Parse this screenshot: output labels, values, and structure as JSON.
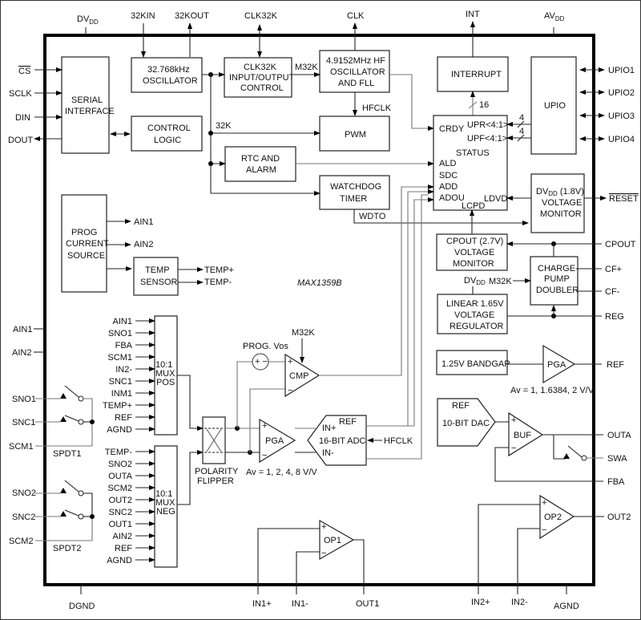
{
  "title": "MAX1359B",
  "power_pins": {
    "dvdd": "DV",
    "dvdd_sub": "DD",
    "avdd": "AV",
    "avdd_sub": "DD",
    "dgnd": "DGND",
    "agnd": "AGND"
  },
  "top_pins": [
    "32KIN",
    "32KOUT",
    "CLK32K",
    "CLK",
    "INT"
  ],
  "left_pins": {
    "serial": [
      "CS",
      "SCLK",
      "DIN",
      "DOUT"
    ],
    "analog": [
      "AIN1",
      "AIN2"
    ],
    "spdt1": [
      "SNO1",
      "SNC1",
      "SCM1"
    ],
    "spdt2": [
      "SNO2",
      "SNC2",
      "SCM2"
    ]
  },
  "right_pins": [
    "UPIO1",
    "UPIO2",
    "UPIO3",
    "UPIO4",
    "RESET",
    "CPOUT",
    "CF+",
    "CF-",
    "REG",
    "REF",
    "OUTA",
    "SWA",
    "FBA",
    "OUT2"
  ],
  "bottom_pins": [
    "IN1+",
    "IN1-",
    "OUT1",
    "IN2+",
    "IN2-"
  ],
  "blocks": {
    "serial_interface": [
      "SERIAL",
      "INTERFACE"
    ],
    "osc32k": [
      "32.768kHz",
      "OSCILLATOR"
    ],
    "clk32k_ctrl": [
      "CLK32K",
      "INPUT/OUTPUT",
      "CONTROL"
    ],
    "hf_osc": [
      "4.9152MHz HF",
      "OSCILLATOR",
      "AND FLL"
    ],
    "interrupt": [
      "INTERRUPT"
    ],
    "upio": [
      "UPIO"
    ],
    "control_logic": [
      "CONTROL",
      "LOGIC"
    ],
    "pwm": [
      "PWM"
    ],
    "rtc": [
      "RTC AND",
      "ALARM"
    ],
    "watchdog": [
      "WATCHDOG",
      "TIMER"
    ],
    "status": {
      "title": "STATUS",
      "inputs_left": [
        "CRDY",
        "ALD",
        "SDC",
        "ADD",
        "ADOU"
      ],
      "inputs_right": [
        "UPR<4:1>",
        "UPF<4:1>",
        "LDVD"
      ],
      "bottom": "LCPD"
    },
    "dvdd_monitor": [
      "DV",
      "DD",
      " (1.8V)",
      "VOLTAGE",
      "MONITOR"
    ],
    "prog_current": [
      "PROG",
      "CURRENT",
      "SOURCE"
    ],
    "temp_sensor": [
      "TEMP",
      "SENSOR"
    ],
    "cpout_monitor": [
      "CPOUT (2.7V)",
      "VOLTAGE",
      "MONITOR"
    ],
    "charge_pump": [
      "CHARGE-",
      "PUMP",
      "DOUBLER"
    ],
    "linear_reg": [
      "LINEAR 1.65V",
      "VOLTAGE",
      "REGULATOR"
    ],
    "bandgap": [
      "1.25V BANDGAP"
    ],
    "pga_ref": "PGA",
    "pga_ref_gain": "Av = 1, 1.6384, 2 V/V",
    "dac": [
      "REF",
      "10-BIT DAC"
    ],
    "buf": "BUF",
    "mux_pos": {
      "label": [
        "10:1",
        "MUX",
        "POS"
      ],
      "inputs": [
        "AIN1",
        "SNO1",
        "FBA",
        "SCM1",
        "IN2-",
        "SNC1",
        "INM1",
        "TEMP+",
        "REF",
        "AGND"
      ]
    },
    "mux_neg": {
      "label": [
        "10:1",
        "MUX",
        "NEG"
      ],
      "inputs": [
        "TEMP-",
        "SNO2",
        "OUTA",
        "SCM2",
        "OUT2",
        "SNC2",
        "OUT1",
        "AIN2",
        "REF",
        "AGND"
      ]
    },
    "polarity_flipper": [
      "POLARITY",
      "FLIPPER"
    ],
    "prog_vos": "PROG. Vos",
    "cmp": "CMP",
    "pga_main": "PGA",
    "pga_main_gain": "Av = 1, 2, 4, 8 V/V",
    "adc": [
      "IN+",
      "REF",
      "16-BIT ADC",
      "IN-"
    ],
    "op1": "OP1",
    "op2": "OP2",
    "spdt1_label": "SPDT1",
    "spdt2_label": "SPDT2"
  },
  "signals": {
    "m32k": "M32K",
    "hfclk": "HFCLK",
    "k32": "32K",
    "wdto": "WDTO",
    "bus16": "16",
    "bus4a": "4",
    "bus4b": "4",
    "prog_ain1": "AIN1",
    "prog_ain2": "AIN2",
    "temp_p": "TEMP+",
    "temp_n": "TEMP-",
    "dvdd_reg": "DV",
    "dvdd_reg_sub": "DD",
    "m32k_cp": "M32K",
    "hfclk_adc": "HFCLK",
    "m32k_cmp": "M32K"
  }
}
